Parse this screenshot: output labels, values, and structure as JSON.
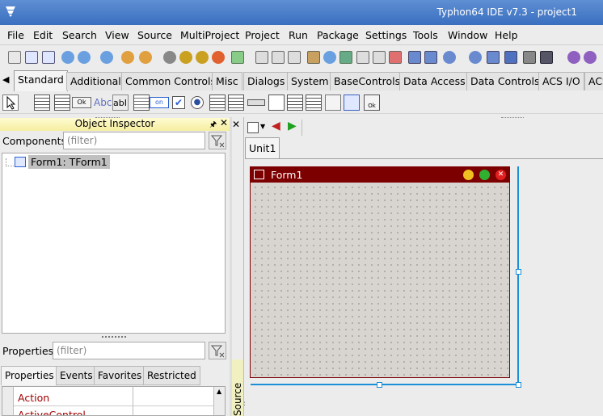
{
  "window": {
    "title": "Typhon64 IDE v7.3 - project1"
  },
  "menu": [
    "File",
    "Edit",
    "Search",
    "View",
    "Source",
    "MultiProject",
    "Project",
    "Run",
    "Package",
    "Settings",
    "Tools",
    "Window",
    "Help"
  ],
  "palette_tabs": [
    "Standard",
    "Additional",
    "Common Controls",
    "Misc",
    "Dialogs",
    "System",
    "BaseControls",
    "Data Access",
    "Data Controls",
    "ACS I/O",
    "ACS"
  ],
  "palette_active": "Standard",
  "object_inspector": {
    "title": "Object Inspector",
    "components_label": "Components",
    "components_filter_placeholder": "(filter)",
    "tree_item": "Form1: TForm1",
    "properties_label": "Properties",
    "properties_filter_placeholder": "(filter)",
    "tabs": [
      "Properties",
      "Events",
      "Favorites",
      "Restricted"
    ],
    "rows": [
      "Action",
      "ActiveControl"
    ]
  },
  "editor": {
    "tab": "Unit1",
    "side_label": "Source Editor",
    "form_caption": "Form1"
  },
  "palette_button_labels": {
    "button": "Ok",
    "label": "Abc",
    "edit": "abI",
    "toggle": "on"
  },
  "colors": {
    "titlebar": "#3a6fc0",
    "form_caption": "#7c0000",
    "selection": "#1a8fd8",
    "property_name": "#a00000"
  }
}
